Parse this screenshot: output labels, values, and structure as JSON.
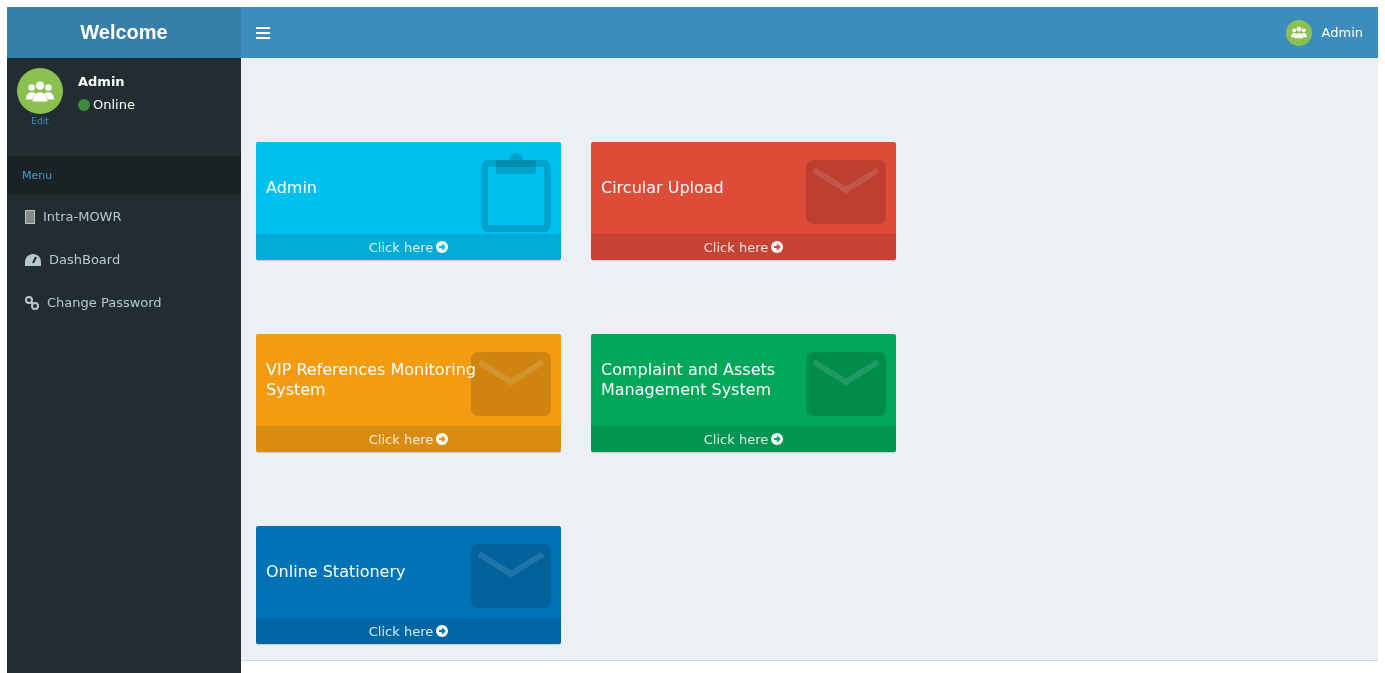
{
  "brand": "Welcome",
  "header": {
    "user": "Admin"
  },
  "user_panel": {
    "name": "Admin",
    "status": {
      "label": "Online",
      "color": "#3c8b3c"
    },
    "edit": "Edit"
  },
  "menu": {
    "header": "Menu",
    "items": [
      {
        "label": "Intra-MOWR",
        "kind": "document"
      },
      {
        "label": "DashBoard",
        "kind": "dashboard"
      },
      {
        "label": "Change Password",
        "kind": "link"
      }
    ]
  },
  "cards": [
    {
      "title": "Admin",
      "link": "Click here",
      "color": "#00c0ef",
      "kind": "clipboard"
    },
    {
      "title": "Circular Upload",
      "link": "Click here",
      "color": "#dd4b39",
      "kind": "envelope"
    },
    {
      "title": "VIP References Monitoring System",
      "link": "Click here",
      "color": "#f39c12",
      "kind": "envelope"
    },
    {
      "title": "Complaint and Assets Management System",
      "link": "Click here",
      "color": "#00a65a",
      "kind": "envelope"
    },
    {
      "title": "Online Stationery",
      "link": "Click here",
      "color": "#0073b7",
      "kind": "envelope"
    }
  ]
}
